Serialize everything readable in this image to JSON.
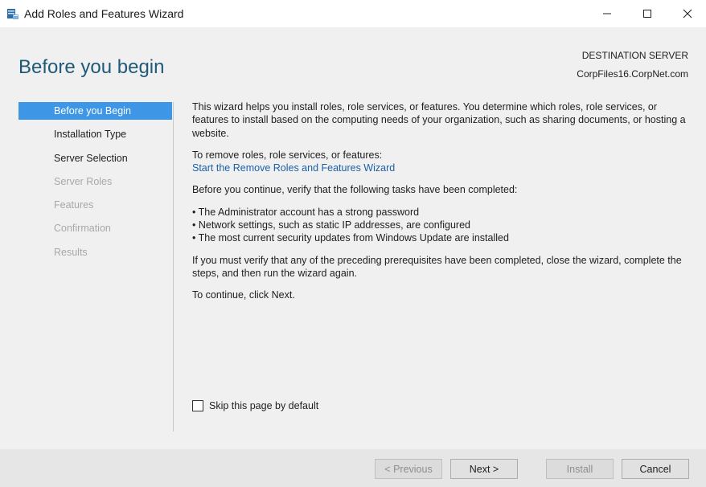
{
  "window": {
    "title": "Add Roles and Features Wizard",
    "app_icon": "server-manager-icon",
    "controls": [
      "minimize-icon",
      "maximize-icon",
      "close-icon"
    ]
  },
  "header": {
    "page_title": "Before you begin",
    "destination_label": "DESTINATION SERVER",
    "destination_server": "CorpFiles16.CorpNet.com"
  },
  "nav": {
    "items": [
      {
        "label": "Before you Begin",
        "state": "active"
      },
      {
        "label": "Installation Type",
        "state": "enabled"
      },
      {
        "label": "Server Selection",
        "state": "enabled"
      },
      {
        "label": "Server Roles",
        "state": "disabled"
      },
      {
        "label": "Features",
        "state": "disabled"
      },
      {
        "label": "Confirmation",
        "state": "disabled"
      },
      {
        "label": "Results",
        "state": "disabled"
      }
    ]
  },
  "content": {
    "intro": "This wizard helps you install roles, role services, or features. You determine which roles, role services, or features to install based on the computing needs of your organization, such as sharing documents, or hosting a website.",
    "remove_label": "To remove roles, role services, or features:",
    "remove_link": "Start the Remove Roles and Features Wizard",
    "verify_text": "Before you continue, verify that the following tasks have been completed:",
    "bullets": [
      "• The Administrator account has a strong password",
      "• Network settings, such as static IP addresses, are configured",
      "• The most current security updates from Windows Update are installed"
    ],
    "prereq_text": "If you must verify that any of the preceding prerequisites have been completed, close the wizard, complete the steps, and then run the wizard again.",
    "continue_text": "To continue, click Next."
  },
  "skip": {
    "label": "Skip this page by default",
    "checked": false
  },
  "footer": {
    "previous_label": "< Previous",
    "next_label": "Next >",
    "install_label": "Install",
    "cancel_label": "Cancel"
  },
  "colors": {
    "accent": "#3d97e6",
    "title": "#1e5a78",
    "link": "#1b5fa8",
    "disabled_text": "#a8a8a8"
  }
}
